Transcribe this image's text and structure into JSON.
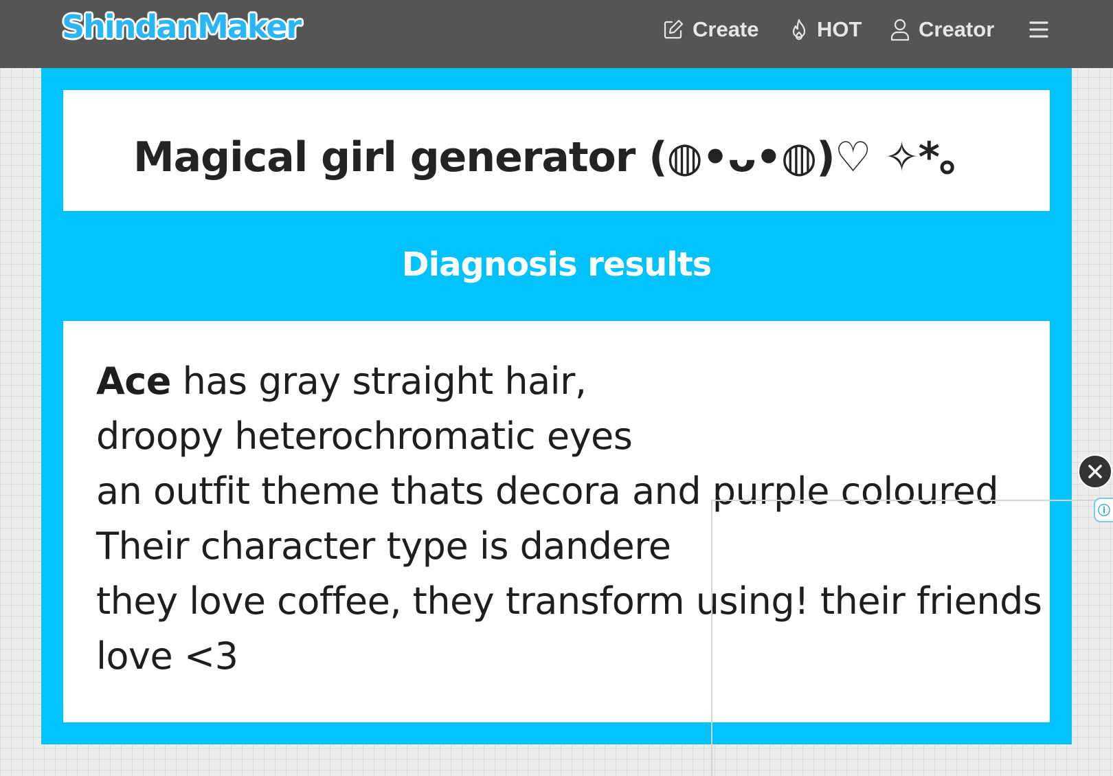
{
  "header": {
    "logo": "ShindanMaker",
    "nav": [
      {
        "label": "Create",
        "icon": "edit-icon"
      },
      {
        "label": "HOT",
        "icon": "flame-icon"
      },
      {
        "label": "Creator",
        "icon": "user-icon"
      }
    ],
    "menu_icon": "hamburger-menu-icon"
  },
  "shindan": {
    "title": "Magical girl generator (◍•ᴗ•◍)♡ ✧*。"
  },
  "results": {
    "heading": "Diagnosis results",
    "name": "Ace",
    "lines": [
      " has gray straight hair,",
      "droopy heterochromatic eyes",
      "an outfit theme thats decora and purple coloured",
      "Their character type is dandere",
      "they love coffee, they transform using! their friends",
      "love <3"
    ]
  },
  "ad": {
    "close_icon": "close-icon",
    "tab_icon": "ad-info-icon"
  },
  "colors": {
    "header_bg": "#555555",
    "accent": "#02c2fb",
    "logo": "#29b6f6"
  }
}
